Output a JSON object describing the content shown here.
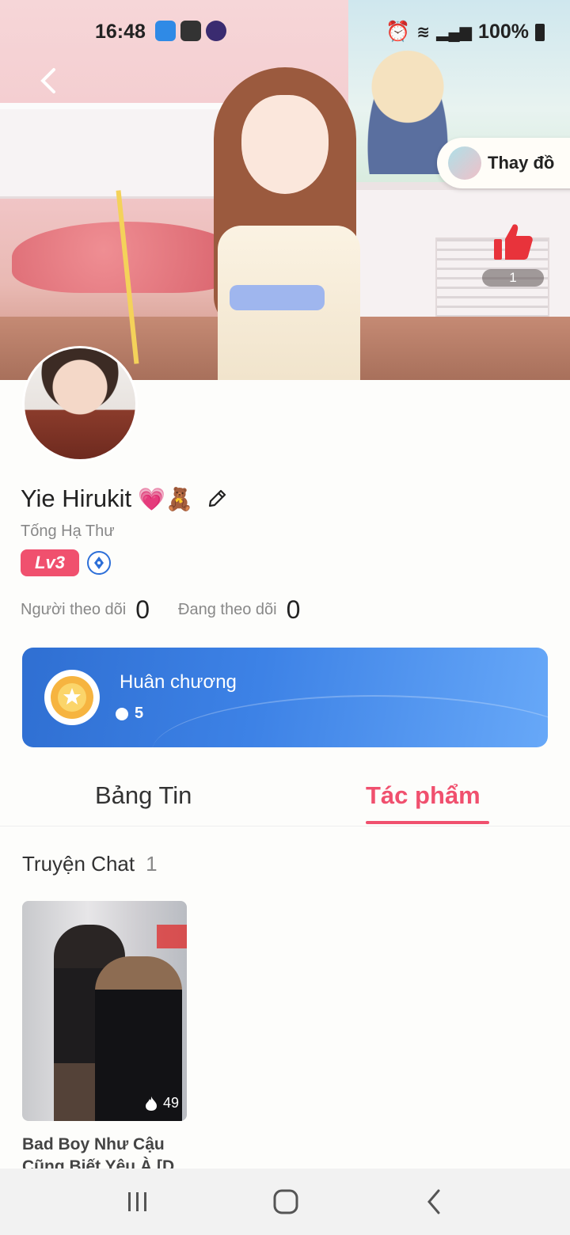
{
  "status_bar": {
    "time": "16:48",
    "battery": "100%"
  },
  "hero": {
    "change_outfit_label": "Thay đồ",
    "like_count": "1"
  },
  "profile": {
    "name": "Yie Hirukit",
    "name_emoji": "💗🧸",
    "subname": "Tống Hạ Thư",
    "level": "Lv3",
    "followers_label": "Người theo dõi",
    "followers_count": "0",
    "following_label": "Đang theo dõi",
    "following_count": "0"
  },
  "medal": {
    "title": "Huân chương",
    "count": "5"
  },
  "tabs": [
    {
      "label": "Bảng Tin",
      "active": false
    },
    {
      "label": "Tác phẩm",
      "active": true
    }
  ],
  "section": {
    "title": "Truyện Chat",
    "count": "1"
  },
  "stories": [
    {
      "title": "Bad Boy Như Cậu Cũng Biết Yêu À [D",
      "views": "49"
    }
  ],
  "colors": {
    "accent": "#f0506e",
    "medal_blue": "#3d82e6"
  }
}
